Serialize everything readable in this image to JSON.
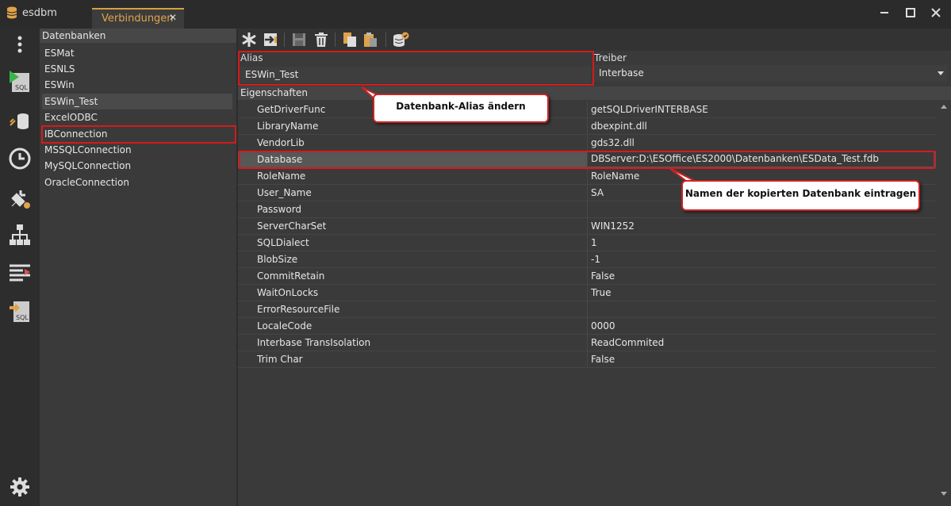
{
  "app": {
    "title": "esdbm"
  },
  "tab": {
    "label": "Verbindungen",
    "close": "✕"
  },
  "window": {
    "minimize": "—",
    "maximize": "☐",
    "close": "✕"
  },
  "databases": {
    "header": "Datenbanken",
    "items": [
      {
        "label": "ESMat"
      },
      {
        "label": "ESNLS"
      },
      {
        "label": "ESWin"
      },
      {
        "label": "ESWin_Test"
      },
      {
        "label": "ExcelODBC"
      },
      {
        "label": "IBConnection"
      },
      {
        "label": "MSSQLConnection"
      },
      {
        "label": "MySQLConnection"
      },
      {
        "label": "OracleConnection"
      }
    ],
    "selected": "ESWin_Test"
  },
  "form": {
    "alias_label": "Alias",
    "alias_value": "ESWin_Test",
    "driver_label": "Treiber",
    "driver_value": "Interbase"
  },
  "properties": {
    "header": "Eigenschaften",
    "rows": [
      {
        "key": "GetDriverFunc",
        "value": "getSQLDriverINTERBASE"
      },
      {
        "key": "LibraryName",
        "value": "dbexpint.dll"
      },
      {
        "key": "VendorLib",
        "value": "gds32.dll"
      },
      {
        "key": "Database",
        "value": "DBServer:D:\\ESOffice\\ES2000\\Datenbanken\\ESData_Test.fdb"
      },
      {
        "key": "RoleName",
        "value": "RoleName"
      },
      {
        "key": "User_Name",
        "value": "SA"
      },
      {
        "key": "Password",
        "value": ""
      },
      {
        "key": "ServerCharSet",
        "value": "WIN1252"
      },
      {
        "key": "SQLDialect",
        "value": "1"
      },
      {
        "key": "BlobSize",
        "value": "-1"
      },
      {
        "key": "CommitRetain",
        "value": "False"
      },
      {
        "key": "WaitOnLocks",
        "value": "True"
      },
      {
        "key": "ErrorResourceFile",
        "value": ""
      },
      {
        "key": "LocaleCode",
        "value": "0000"
      },
      {
        "key": "Interbase TransIsolation",
        "value": "ReadCommited"
      },
      {
        "key": "Trim Char",
        "value": "False"
      }
    ]
  },
  "annotations": {
    "alias": "Datenbank-Alias ändern",
    "database": "Namen der kopierten Datenbank eintragen"
  },
  "colors": {
    "accent": "#e0a34a",
    "highlight": "#d41b1b"
  },
  "icons": {
    "sidebar": [
      "more-vert-icon",
      "sql-run-icon",
      "db-sync-icon",
      "history-icon",
      "plugin-settings-icon",
      "hierarchy-icon",
      "list-compare-icon",
      "sql-export-icon",
      "settings-gear-icon"
    ],
    "toolbar": [
      "new-icon",
      "import-icon",
      "save-icon",
      "delete-icon",
      "copy-icon",
      "paste-icon",
      "db-check-icon"
    ]
  }
}
